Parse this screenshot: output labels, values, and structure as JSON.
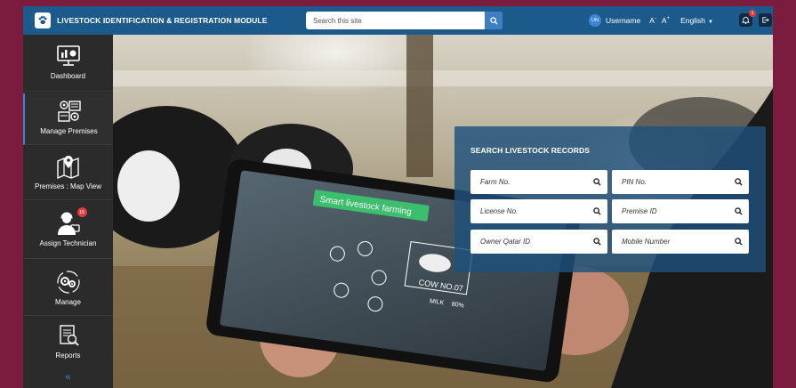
{
  "header": {
    "app_title": "LIVESTOCK IDENTIFICATION & REGISTRATION MODULE",
    "search_placeholder": "Search this site",
    "avatar_initials": "UN",
    "username": "Username",
    "font_decrease": "A",
    "font_decrease_sup": "-",
    "font_increase": "A",
    "font_increase_sup": "+",
    "language": "English",
    "notification_count": "1"
  },
  "sidebar": {
    "items": [
      {
        "label": "Dashboard",
        "icon": "dashboard-icon"
      },
      {
        "label": "Manage Premises",
        "icon": "premises-icon"
      },
      {
        "label": "Premises : Map View",
        "icon": "map-icon"
      },
      {
        "label": "Assign Technician",
        "icon": "technician-icon",
        "badge": "15"
      },
      {
        "label": "Manage",
        "icon": "gears-icon"
      },
      {
        "label": "Reports",
        "icon": "reports-icon"
      }
    ],
    "collapse_glyph": "«"
  },
  "search_panel": {
    "title": "SEARCH LIVESTOCK RECORDS",
    "fields": [
      {
        "placeholder": "Farm No."
      },
      {
        "placeholder": "PIN No."
      },
      {
        "placeholder": "License No."
      },
      {
        "placeholder": "Premise ID"
      },
      {
        "placeholder": "Owner Qatar ID"
      },
      {
        "placeholder": "Mobile Number"
      }
    ]
  },
  "hero_image": {
    "tablet_banner": "Smart livestock farming",
    "tablet_label": "COW NO.07",
    "milk_label": "MILK",
    "milk_percent": "80%"
  },
  "colors": {
    "frame": "#7b1b3d",
    "topbar": "#1d5a8c",
    "sidebar": "#2b2b2b",
    "accent": "#3d86d4",
    "panel": "#1e507d",
    "badge": "#e23b3b"
  }
}
